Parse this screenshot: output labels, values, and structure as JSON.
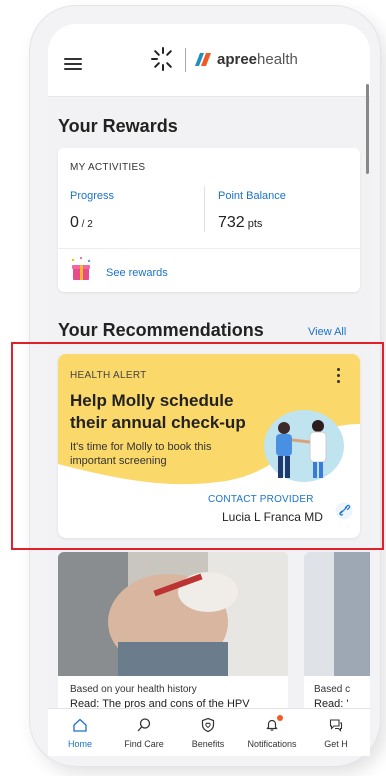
{
  "brand": {
    "name_bold": "apree",
    "name_light": "health"
  },
  "rewards": {
    "heading": "Your Rewards",
    "activities_label": "MY ACTIVITIES",
    "progress_label": "Progress",
    "progress_value": "0",
    "progress_total": " / 2",
    "balance_label": "Point Balance",
    "balance_value": "732",
    "balance_unit": " pts",
    "see_rewards": "See rewards"
  },
  "recommendations": {
    "heading": "Your Recommendations",
    "view_all": "View All"
  },
  "alert": {
    "kicker": "HEALTH ALERT",
    "title": "Help Molly schedule their annual check-up",
    "body": "It's time for Molly to book this important screening",
    "contact": "CONTACT PROVIDER",
    "provider": "Lucia L Franca MD"
  },
  "articles": [
    {
      "sub": "Based on your health history",
      "title": "Read: The pros and cons of the HPV vaccine"
    },
    {
      "sub": "Based c",
      "title": "Read: '"
    }
  ],
  "tabs": [
    {
      "label": "Home",
      "icon": "home-icon"
    },
    {
      "label": "Find Care",
      "icon": "search-icon"
    },
    {
      "label": "Benefits",
      "icon": "shield-icon"
    },
    {
      "label": "Notifications",
      "icon": "bell-icon"
    },
    {
      "label": "Get H",
      "icon": "chat-icon"
    }
  ],
  "colors": {
    "accent": "#1a73c9",
    "alert_yellow": "#fad86a",
    "notification": "#f15a22",
    "highlight": "#e0202a"
  }
}
